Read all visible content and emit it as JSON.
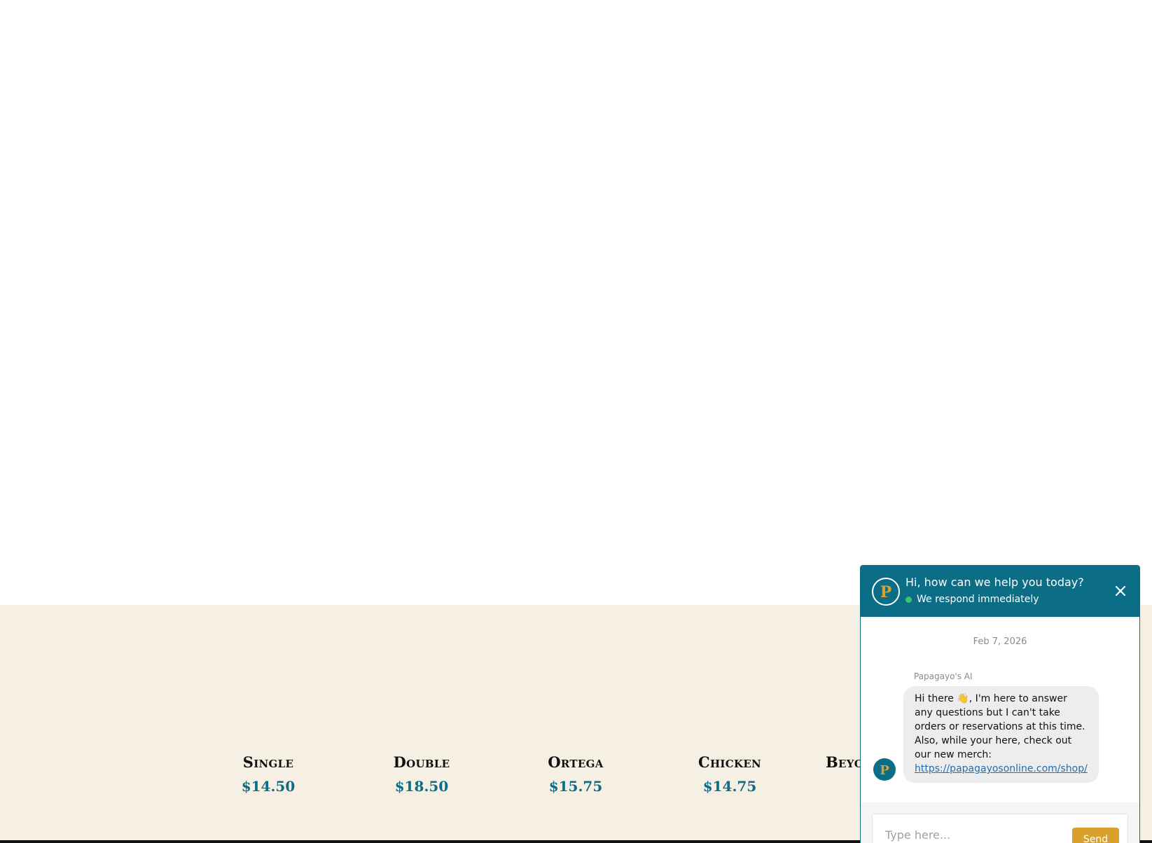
{
  "menu": {
    "items": [
      {
        "name": "Single",
        "price": "$14.50"
      },
      {
        "name": "Double",
        "price": "$18.50"
      },
      {
        "name": "Ortega",
        "price": "$15.75"
      },
      {
        "name": "Chicken",
        "price": "$14.75"
      },
      {
        "name": "Beyo",
        "price": ""
      }
    ]
  },
  "chat": {
    "title": "Hi, how can we help you today?",
    "status": "We respond immediately",
    "date": "Feb 7, 2026",
    "sender": "Papagayo's AI",
    "message": "Hi there 👋, I'm here to answer any questions but I can't take orders or reservations at this time. Also, while your here, check out our new merch:",
    "link": "https://papagayosonline.com/shop/",
    "input_placeholder": "Type here...",
    "send_label": "Send",
    "logo_letter": "P"
  },
  "colors": {
    "brand_teal": "#0b6d86",
    "accent_gold": "#d9a12b",
    "menu_background": "#f6efe3",
    "status_green": "#3cc46a"
  },
  "icons": {
    "close": "close-icon",
    "logo": "papagayos-logo-icon",
    "status": "online-status-icon"
  }
}
